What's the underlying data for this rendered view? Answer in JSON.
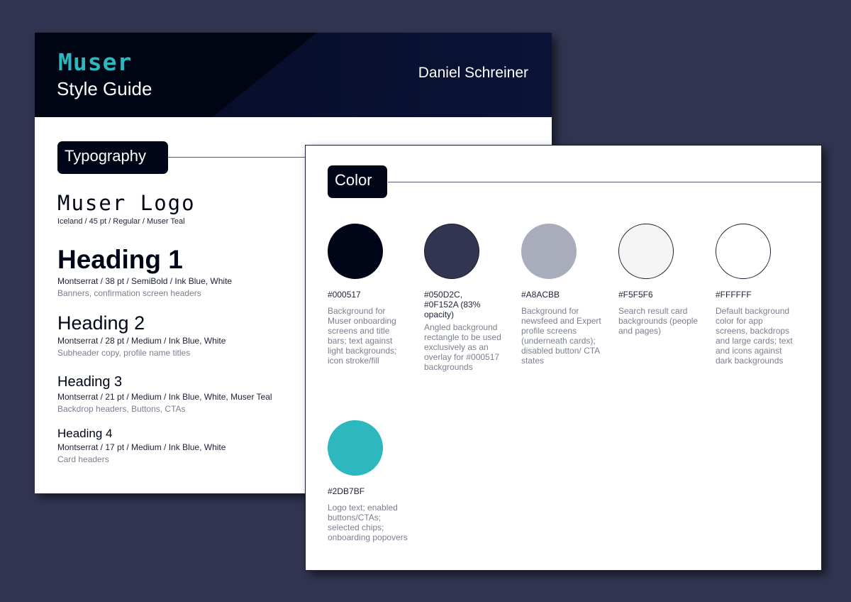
{
  "header": {
    "logo": "Muser",
    "subtitle": "Style Guide",
    "author": "Daniel Schreiner"
  },
  "typography": {
    "section_label": "Typography",
    "items": [
      {
        "sample": "Muser Logo",
        "spec": "Iceland / 45 pt / Regular / Muser Teal",
        "usage": ""
      },
      {
        "sample": "Heading 1",
        "spec": "Montserrat / 38 pt / SemiBold / Ink Blue, White",
        "usage": "Banners, confirmation screen headers"
      },
      {
        "sample": "Heading 2",
        "spec": "Montserrat / 28 pt / Medium / Ink Blue, White",
        "usage": "Subheader copy, profile name titles"
      },
      {
        "sample": "Heading 3",
        "spec": "Montserrat / 21 pt / Medium / Ink Blue, White, Muser Teal",
        "usage": "Backdrop headers, Buttons, CTAs"
      },
      {
        "sample": "Heading 4",
        "spec": "Montserrat / 17 pt / Medium / Ink Blue, White",
        "usage": "Card headers"
      }
    ]
  },
  "color": {
    "section_label": "Color",
    "swatches": [
      {
        "hex_label": "#000517",
        "fill": "#000517",
        "border": "#000517",
        "description": "Background for Muser onboarding screens and title bars; text against light backgrounds; icon stroke/fill"
      },
      {
        "hex_label": "#050D2C, #0F152A (83% opacity)",
        "fill": "#313551",
        "border": "#1a1d2c",
        "description": "Angled background rectangle to be used exclusively as an overlay for #000517 backgrounds"
      },
      {
        "hex_label": "#A8ACBB",
        "fill": "#A8ACBB",
        "border": "#A8ACBB",
        "description": "Background for newsfeed and Expert profile screens (underneath cards); disabled button/ CTA states"
      },
      {
        "hex_label": "#F5F5F6",
        "fill": "#F5F5F6",
        "border": "#1c2035",
        "description": "Search result card backgrounds (people and pages)"
      },
      {
        "hex_label": "#FFFFFF",
        "fill": "#FFFFFF",
        "border": "#1c2035",
        "description": "Default background color for app screens, backdrops and large cards; text and icons against dark backgrounds"
      },
      {
        "hex_label": "#2DB7BF",
        "fill": "#2DB7BF",
        "border": "#2DB7BF",
        "description": "Logo text; enabled buttons/CTAs; selected chips; onboarding popovers"
      }
    ]
  }
}
